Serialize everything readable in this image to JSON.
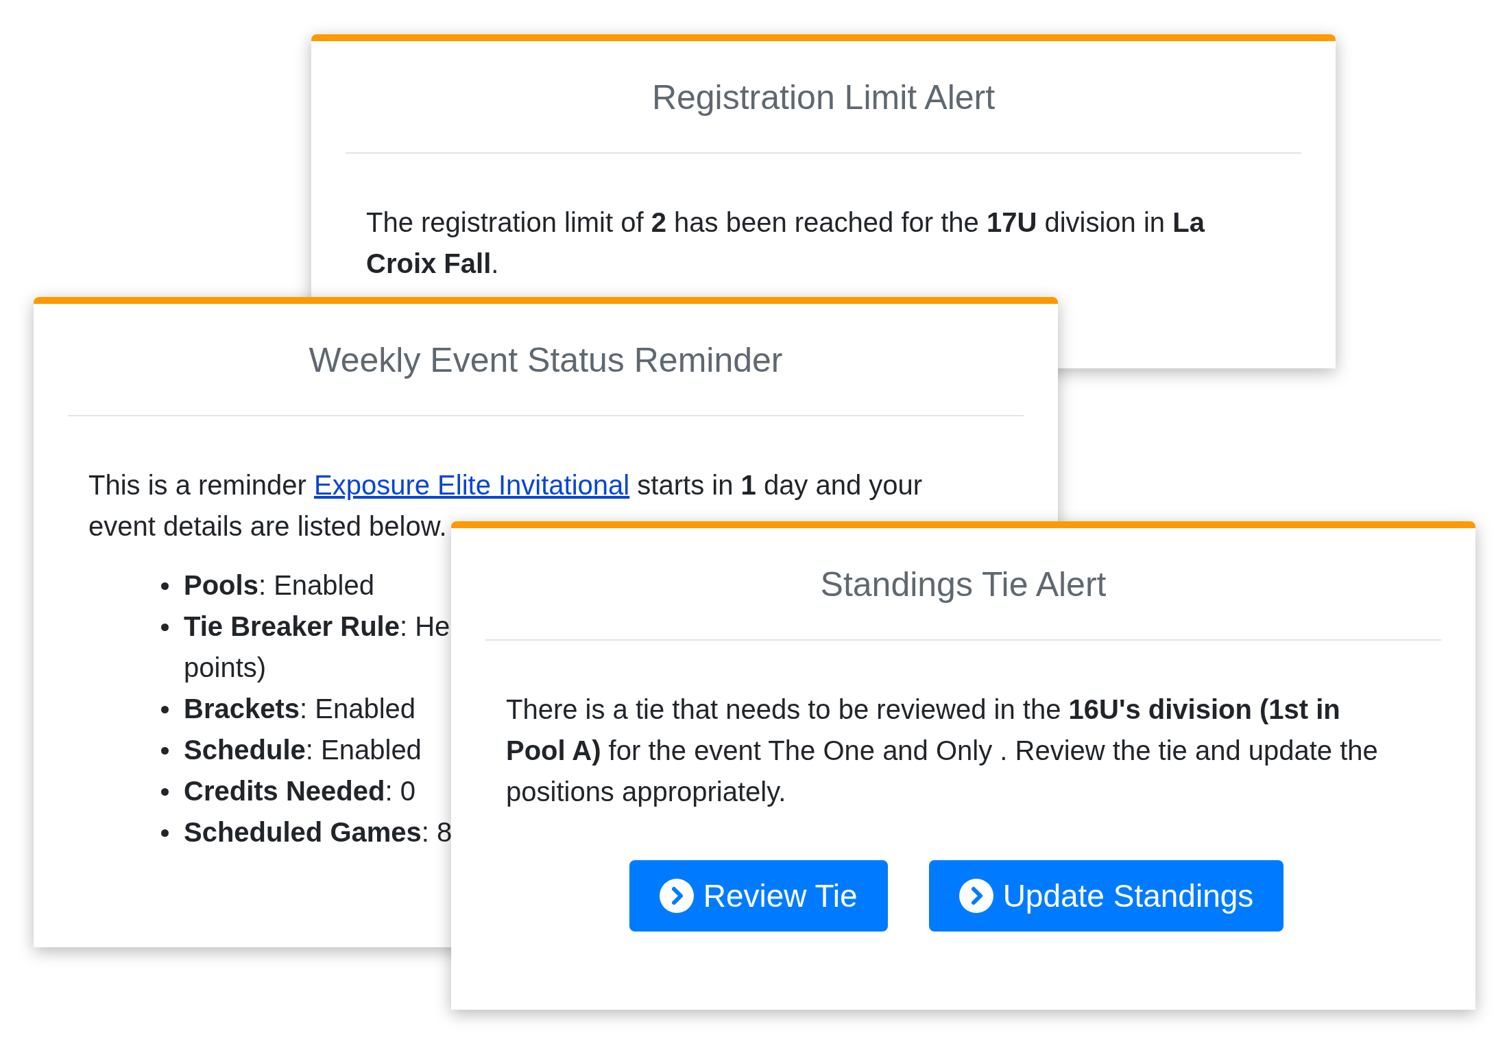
{
  "cards": [
    {
      "title": "Registration Limit Alert",
      "paragraphs": [
        {
          "text": "The registration limit of **2** has been reached for the **17U** division in **La Croix Fall**."
        }
      ]
    },
    {
      "title": "Weekly Event Status Reminder",
      "paragraphs": [
        {
          "text": "This is a reminder ",
          "link": "Exposure Elite Invitational",
          "after": " starts in **1** day and your event details are listed below."
        }
      ],
      "items": [
        {
          "text": "**Pools**: Enabled"
        },
        {
          "text": "**Tie Breaker Rule**: He",
          "continuation": "points)"
        },
        {
          "text": "**Brackets**: Enabled"
        },
        {
          "text": "**Schedule**: Enabled"
        },
        {
          "text": "**Credits Needed**: 0"
        },
        {
          "text": "**Scheduled Games**: 8"
        }
      ]
    },
    {
      "title": "Standings Tie Alert",
      "paragraphs": [
        {
          "text": "There is a tie that needs to be reviewed in the **16U's division (1st in Pool A)** for the event The One and Only . Review the tie and update the positions appropriately."
        }
      ],
      "buttons": [
        "Review Tie",
        "Update Standings"
      ]
    }
  ]
}
